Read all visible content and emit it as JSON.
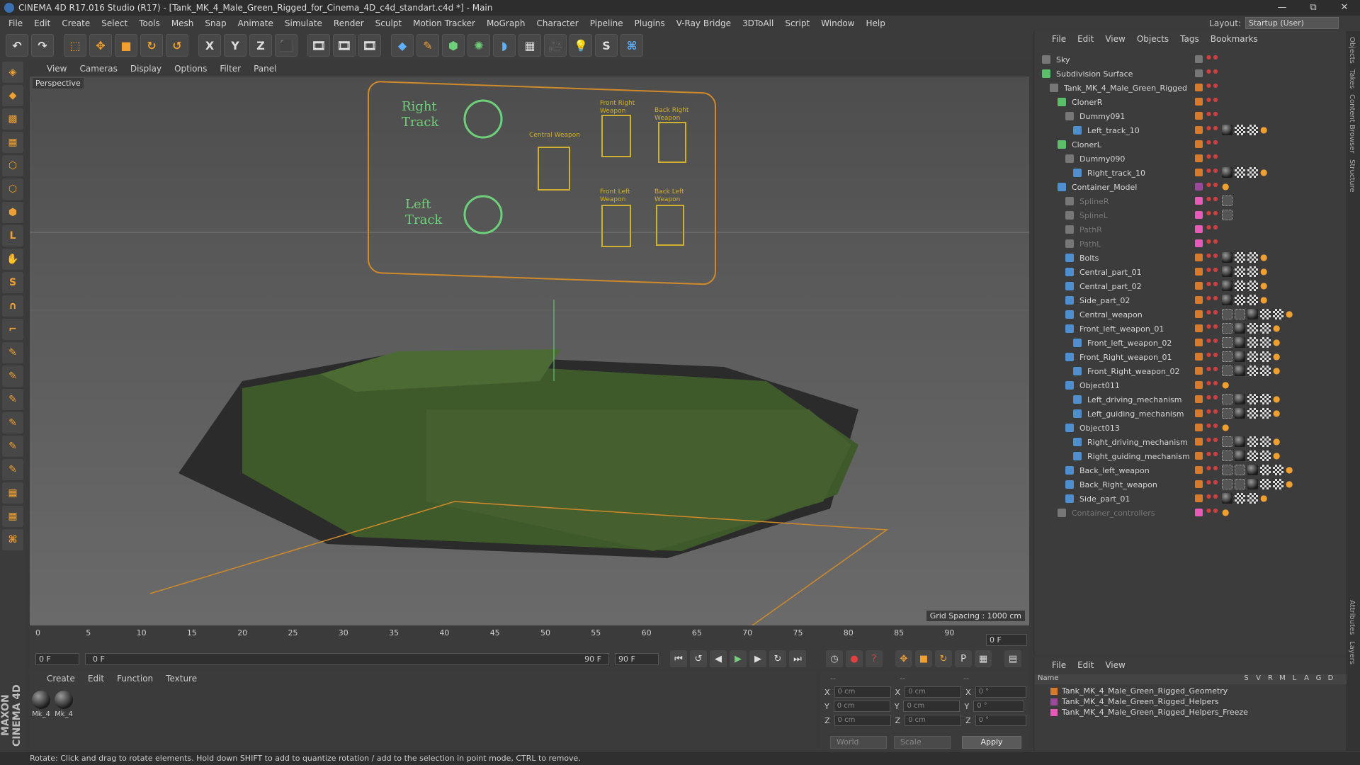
{
  "title_bar": {
    "text": "CINEMA 4D R17.016 Studio (R17) - [Tank_MK_4_Male_Green_Rigged_for_Cinema_4D_c4d_standart.c4d *] - Main"
  },
  "window_controls": {
    "minimize": "—",
    "maximize": "⧉",
    "close": "✕"
  },
  "menu": [
    "File",
    "Edit",
    "Create",
    "Select",
    "Tools",
    "Mesh",
    "Snap",
    "Animate",
    "Simulate",
    "Render",
    "Sculpt",
    "Motion Tracker",
    "MoGraph",
    "Character",
    "Pipeline",
    "Plugins",
    "V-Ray Bridge",
    "3DToAll",
    "Script",
    "Window",
    "Help"
  ],
  "layout": {
    "label": "Layout:",
    "value": "Startup (User)"
  },
  "toolbar": [
    "undo-icon",
    "redo-icon",
    "live-selection-icon",
    "move-icon",
    "scale-icon",
    "rotate-icon",
    "recent-icon",
    "x-axis-icon",
    "y-axis-icon",
    "z-axis-icon",
    "coordinate-icon",
    "render-view-icon",
    "render-picture-icon",
    "render-settings-icon",
    "cube-icon",
    "pen-icon",
    "subdivision-icon",
    "cloner-icon",
    "deformer-icon",
    "floor-icon",
    "camera-icon",
    "light-icon",
    "vray-icon",
    "python-icon"
  ],
  "toolbar_glyphs": {
    "x": "X",
    "y": "Y",
    "z": "Z"
  },
  "viewport_menu": [
    "View",
    "Cameras",
    "Display",
    "Options",
    "Filter",
    "Panel"
  ],
  "viewport": {
    "label": "Perspective",
    "grid_spacing": "Grid Spacing : 1000 cm",
    "hud": {
      "right_track": "Right\nTrack",
      "left_track": "Left\nTrack",
      "central_weapon": "Central Weapon",
      "front_right_weapon": "Front Right Weapon",
      "back_right_weapon": "Back Right Weapon",
      "front_left_weapon": "Front Left Weapon",
      "back_left_weapon": "Back Left Weapon"
    }
  },
  "timeline": {
    "ticks": [
      "0",
      "5",
      "10",
      "15",
      "20",
      "25",
      "30",
      "35",
      "40",
      "45",
      "50",
      "55",
      "60",
      "65",
      "70",
      "75",
      "80",
      "85",
      "90"
    ],
    "current": "0 F"
  },
  "transport": {
    "start_frame": "0 F",
    "min_field": "0 F",
    "max_field": "90 F",
    "end_frame": "90 F"
  },
  "materials": {
    "menu": [
      "Create",
      "Edit",
      "Function",
      "Texture"
    ],
    "items": [
      "Mk_4",
      "Mk_4"
    ]
  },
  "coords": {
    "headers": [
      "--",
      "--",
      "--"
    ],
    "rows": [
      {
        "axis": "X",
        "pos": "0 cm",
        "axis2": "X",
        "size": "0 cm",
        "axis3": "X",
        "rot": "0 °"
      },
      {
        "axis": "Y",
        "pos": "0 cm",
        "axis2": "Y",
        "size": "0 cm",
        "axis3": "Y",
        "rot": "0 °"
      },
      {
        "axis": "Z",
        "pos": "0 cm",
        "axis2": "Z",
        "size": "0 cm",
        "axis3": "Z",
        "rot": "0 °"
      }
    ],
    "world": "World",
    "scale": "Scale",
    "apply": "Apply"
  },
  "brand": "MAXON CINEMA 4D",
  "status": "Rotate: Click and drag to rotate elements. Hold down SHIFT to add to quantize rotation / add to the selection in point mode, CTRL to remove.",
  "object_manager": {
    "menu": [
      "File",
      "Edit",
      "View",
      "Objects",
      "Tags",
      "Bookmarks"
    ],
    "objects": [
      {
        "name": "Sky",
        "indent": 0,
        "icon": "grey",
        "layer": "grey",
        "tags": []
      },
      {
        "name": "Subdivision Surface",
        "indent": 0,
        "icon": "green",
        "layer": "grey",
        "tags": []
      },
      {
        "name": "Tank_MK_4_Male_Green_Rigged",
        "indent": 1,
        "icon": "grey",
        "layer": "orange",
        "tags": []
      },
      {
        "name": "ClonerR",
        "indent": 2,
        "icon": "green",
        "layer": "orange",
        "tags": []
      },
      {
        "name": "Dummy091",
        "indent": 3,
        "icon": "grey",
        "layer": "orange",
        "tags": []
      },
      {
        "name": "Left_track_10",
        "indent": 4,
        "icon": "blue",
        "layer": "orange",
        "tags": [
          "m",
          "c",
          "c",
          "s"
        ]
      },
      {
        "name": "ClonerL",
        "indent": 2,
        "icon": "green",
        "layer": "orange",
        "tags": []
      },
      {
        "name": "Dummy090",
        "indent": 3,
        "icon": "grey",
        "layer": "orange",
        "tags": []
      },
      {
        "name": "Right_track_10",
        "indent": 4,
        "icon": "blue",
        "layer": "orange",
        "tags": [
          "m",
          "c",
          "c",
          "s"
        ]
      },
      {
        "name": "Container_Model",
        "indent": 2,
        "icon": "blue",
        "layer": "purple",
        "tags": [
          "s"
        ]
      },
      {
        "name": "SplineR",
        "indent": 3,
        "icon": "grey",
        "layer": "pink",
        "tags": [
          "p"
        ],
        "dim": true
      },
      {
        "name": "SplineL",
        "indent": 3,
        "icon": "grey",
        "layer": "pink",
        "tags": [
          "p"
        ],
        "dim": true
      },
      {
        "name": "PathR",
        "indent": 3,
        "icon": "grey",
        "layer": "pink",
        "tags": [],
        "dim": true
      },
      {
        "name": "PathL",
        "indent": 3,
        "icon": "grey",
        "layer": "pink",
        "tags": [],
        "dim": true
      },
      {
        "name": "Bolts",
        "indent": 3,
        "icon": "blue",
        "layer": "orange",
        "tags": [
          "m",
          "c",
          "c",
          "s"
        ]
      },
      {
        "name": "Central_part_01",
        "indent": 3,
        "icon": "blue",
        "layer": "orange",
        "tags": [
          "m",
          "c",
          "c",
          "s"
        ]
      },
      {
        "name": "Central_part_02",
        "indent": 3,
        "icon": "blue",
        "layer": "orange",
        "tags": [
          "m",
          "c",
          "c",
          "s"
        ]
      },
      {
        "name": "Side_part_02",
        "indent": 3,
        "icon": "blue",
        "layer": "orange",
        "tags": [
          "m",
          "c",
          "c",
          "s"
        ]
      },
      {
        "name": "Central_weapon",
        "indent": 3,
        "icon": "blue",
        "layer": "orange",
        "tags": [
          "p",
          "p",
          "m",
          "c",
          "c",
          "s"
        ]
      },
      {
        "name": "Front_left_weapon_01",
        "indent": 3,
        "icon": "blue",
        "layer": "orange",
        "tags": [
          "p",
          "m",
          "c",
          "c",
          "s"
        ]
      },
      {
        "name": "Front_left_weapon_02",
        "indent": 4,
        "icon": "blue",
        "layer": "orange",
        "tags": [
          "p",
          "m",
          "c",
          "c",
          "s"
        ]
      },
      {
        "name": "Front_Right_weapon_01",
        "indent": 3,
        "icon": "blue",
        "layer": "orange",
        "tags": [
          "p",
          "m",
          "c",
          "c",
          "s"
        ]
      },
      {
        "name": "Front_Right_weapon_02",
        "indent": 4,
        "icon": "blue",
        "layer": "orange",
        "tags": [
          "p",
          "m",
          "c",
          "c",
          "s"
        ]
      },
      {
        "name": "Object011",
        "indent": 3,
        "icon": "blue",
        "layer": "orange",
        "tags": [
          "s"
        ]
      },
      {
        "name": "Left_driving_mechanism",
        "indent": 4,
        "icon": "blue",
        "layer": "orange",
        "tags": [
          "p",
          "m",
          "c",
          "c",
          "s"
        ]
      },
      {
        "name": "Left_guiding_mechanism",
        "indent": 4,
        "icon": "blue",
        "layer": "orange",
        "tags": [
          "p",
          "m",
          "c",
          "c",
          "s"
        ]
      },
      {
        "name": "Object013",
        "indent": 3,
        "icon": "blue",
        "layer": "orange",
        "tags": [
          "s"
        ]
      },
      {
        "name": "Right_driving_mechanism",
        "indent": 4,
        "icon": "blue",
        "layer": "orange",
        "tags": [
          "p",
          "m",
          "c",
          "c",
          "s"
        ]
      },
      {
        "name": "Right_guiding_mechanism",
        "indent": 4,
        "icon": "blue",
        "layer": "orange",
        "tags": [
          "p",
          "m",
          "c",
          "c",
          "s"
        ]
      },
      {
        "name": "Back_left_weapon",
        "indent": 3,
        "icon": "blue",
        "layer": "orange",
        "tags": [
          "p",
          "p",
          "m",
          "c",
          "c",
          "s"
        ]
      },
      {
        "name": "Back_Right_weapon",
        "indent": 3,
        "icon": "blue",
        "layer": "orange",
        "tags": [
          "p",
          "p",
          "m",
          "c",
          "c",
          "s"
        ]
      },
      {
        "name": "Side_part_01",
        "indent": 3,
        "icon": "blue",
        "layer": "orange",
        "tags": [
          "m",
          "c",
          "c",
          "s"
        ]
      },
      {
        "name": "Container_controllers",
        "indent": 2,
        "icon": "grey",
        "layer": "pink",
        "tags": [
          "s"
        ],
        "dim": true
      }
    ]
  },
  "side_tabs": [
    "Objects",
    "Takes",
    "Content Browser",
    "Structure"
  ],
  "side_tabs_lower": [
    "Attributes",
    "Layers"
  ],
  "layer_manager": {
    "menu": [
      "File",
      "Edit",
      "View"
    ],
    "columns": [
      "Name",
      "S",
      "V",
      "R",
      "M",
      "L",
      "A",
      "G",
      "D"
    ],
    "layers": [
      {
        "name": "Tank_MK_4_Male_Green_Rigged_Geometry",
        "color": "#d77a2c"
      },
      {
        "name": "Tank_MK_4_Male_Green_Rigged_Helpers",
        "color": "#9b4a9b"
      },
      {
        "name": "Tank_MK_4_Male_Green_Rigged_Helpers_Freeze",
        "color": "#e85ab8"
      }
    ]
  },
  "colors": {
    "accent": "#f0a030",
    "hud_green": "#6fd07a",
    "hud_orange": "#d08a2a",
    "tank": "#3f5a2a"
  }
}
